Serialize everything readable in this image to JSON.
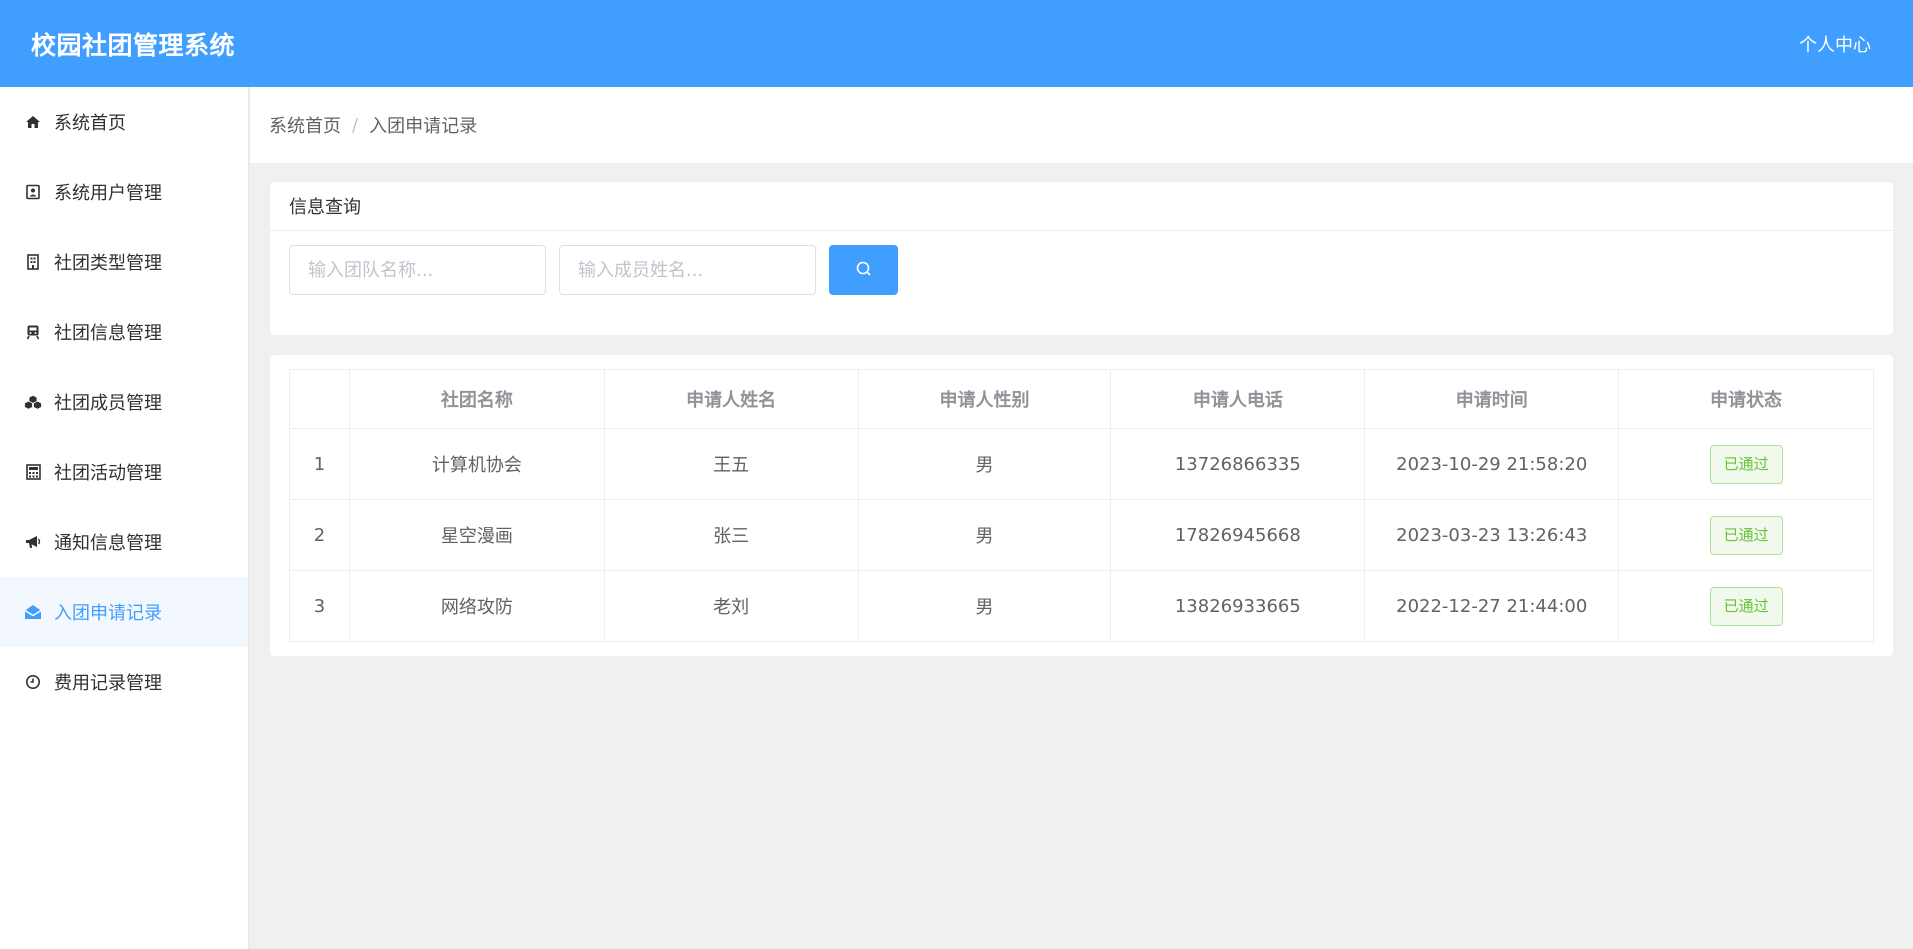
{
  "header": {
    "title": "校园社团管理系统",
    "user_center": "个人中心",
    "bg_color": "#409eff"
  },
  "sidebar": {
    "items": [
      {
        "label": "系统首页",
        "icon": "home-icon"
      },
      {
        "label": "系统用户管理",
        "icon": "contact-card-icon"
      },
      {
        "label": "社团类型管理",
        "icon": "building-icon"
      },
      {
        "label": "社团信息管理",
        "icon": "train-icon"
      },
      {
        "label": "社团成员管理",
        "icon": "cubes-icon"
      },
      {
        "label": "社团活动管理",
        "icon": "calculator-icon"
      },
      {
        "label": "通知信息管理",
        "icon": "bullhorn-icon"
      },
      {
        "label": "入团申请记录",
        "icon": "envelope-open-icon",
        "active": true
      },
      {
        "label": "费用记录管理",
        "icon": "clock-icon"
      }
    ],
    "active_color": "#409eff"
  },
  "breadcrumb": {
    "home": "系统首页",
    "separator": "/",
    "current": "入团申请记录"
  },
  "query": {
    "title": "信息查询",
    "team_placeholder": "输入团队名称...",
    "member_placeholder": "输入成员姓名...",
    "search_icon": "search-icon"
  },
  "table": {
    "columns": [
      "",
      "社团名称",
      "申请人姓名",
      "申请人性别",
      "申请人电话",
      "申请时间",
      "申请状态"
    ],
    "rows": [
      {
        "index": "1",
        "club": "计算机协会",
        "name": "王五",
        "gender": "男",
        "phone": "13726866335",
        "time": "2023-10-29 21:58:20",
        "status": "已通过"
      },
      {
        "index": "2",
        "club": "星空漫画",
        "name": "张三",
        "gender": "男",
        "phone": "17826945668",
        "time": "2023-03-23 13:26:43",
        "status": "已通过"
      },
      {
        "index": "3",
        "club": "网络攻防",
        "name": "老刘",
        "gender": "男",
        "phone": "13826933665",
        "time": "2022-12-27 21:44:00",
        "status": "已通过"
      }
    ],
    "status_color": "#67c23a"
  }
}
